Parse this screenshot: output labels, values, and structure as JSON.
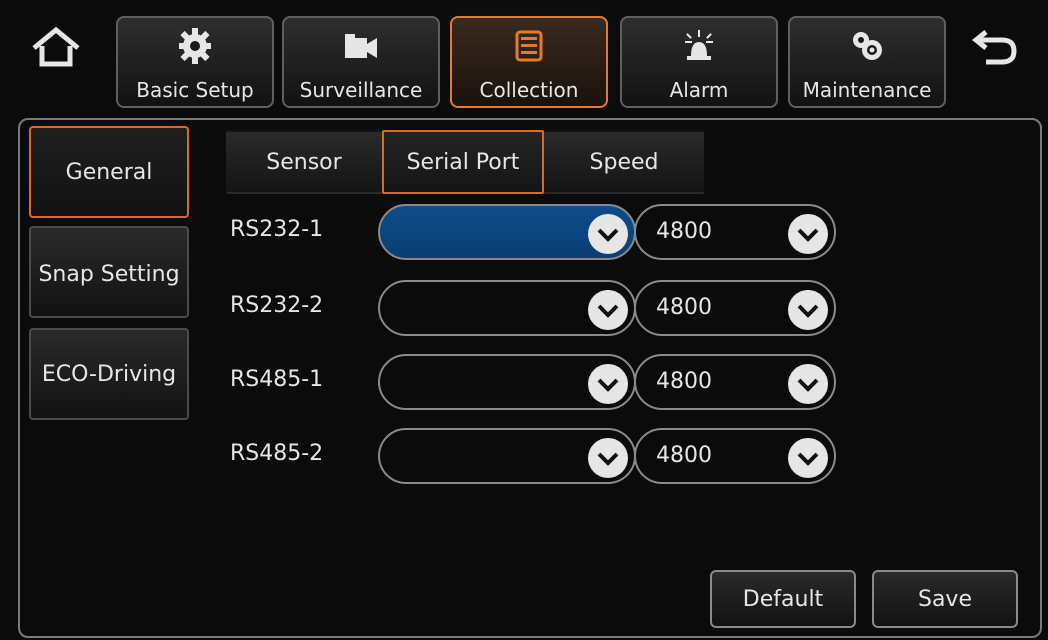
{
  "top_nav": {
    "tabs": [
      {
        "label": "Basic Setup",
        "icon": "gear-icon",
        "active": false
      },
      {
        "label": "Surveillance",
        "icon": "video-camera-icon",
        "active": false
      },
      {
        "label": "Collection",
        "icon": "collection-icon",
        "active": true
      },
      {
        "label": "Alarm",
        "icon": "alarm-light-icon",
        "active": false
      },
      {
        "label": "Maintenance",
        "icon": "maintenance-gears-icon",
        "active": false
      }
    ],
    "home_icon": "home-icon",
    "back_icon": "back-arrow-icon"
  },
  "sidebar": {
    "items": [
      {
        "label": "General",
        "active": true
      },
      {
        "label": "Snap Setting",
        "active": false
      },
      {
        "label": "ECO-Driving",
        "active": false
      }
    ]
  },
  "sub_tabs": [
    {
      "label": "Sensor",
      "active": false
    },
    {
      "label": "Serial Port",
      "active": true
    },
    {
      "label": "Speed",
      "active": false
    }
  ],
  "ports": [
    {
      "label": "RS232-1",
      "device": "",
      "baud": "4800",
      "highlight": true
    },
    {
      "label": "RS232-2",
      "device": "",
      "baud": "4800",
      "highlight": false
    },
    {
      "label": "RS485-1",
      "device": "",
      "baud": "4800",
      "highlight": false
    },
    {
      "label": "RS485-2",
      "device": "",
      "baud": "4800",
      "highlight": false
    }
  ],
  "actions": {
    "default_label": "Default",
    "save_label": "Save"
  },
  "colors": {
    "accent": "#d96b22",
    "highlight_blue": "#0f4c8a",
    "background": "#0b0b0b"
  }
}
